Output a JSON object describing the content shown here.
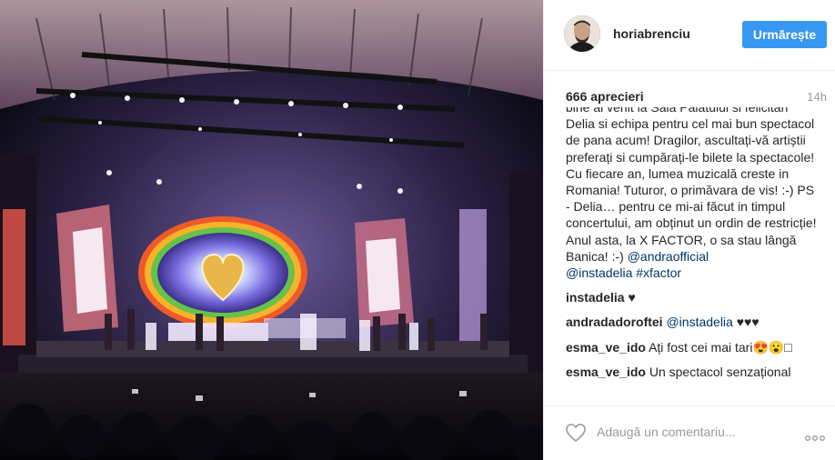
{
  "post": {
    "username": "horiabrenciu",
    "follow_label": "Urmărește",
    "likes": "666 aprecieri",
    "time": "14h",
    "caption_text": "bine ai venit la Sala Palatului si felicitari Delia si echipa pentru cel mai bun spectacol de pana acum! Dragilor, ascultați-vă artiștii preferați si cumpărați-le bilete la spectacole! Cu fiecare an, lumea muzicală creste in Romania! Tuturor, o primăvara de vis! :-) PS - Delia… pentru ce mi-ai făcut in timpul concertului, am obținut un ordin de restricție! Anul asta, la X FACTOR, o sa stau lângă Banica! :-)",
    "caption_mentions": [
      "@andraofficial",
      "@instadelia",
      "#xfactor"
    ]
  },
  "comments": [
    {
      "user": "instadelia",
      "text": "♥"
    },
    {
      "user": "andradadoroftei",
      "mention": "@instadelia",
      "text": "♥♥♥"
    },
    {
      "user": "esma_ve_ido",
      "text": "Ați fost cei mai tari😍😮□"
    },
    {
      "user": "esma_ve_ido",
      "text": "Un spectacol senzațional"
    }
  ],
  "footer": {
    "comment_placeholder": "Adaugă un comentariu...",
    "like_icon": "heart-outline-icon",
    "more_icon": "more-options-icon"
  },
  "colors": {
    "accent": "#3897f0",
    "link": "#003569",
    "text": "#262626",
    "muted": "#999999"
  }
}
